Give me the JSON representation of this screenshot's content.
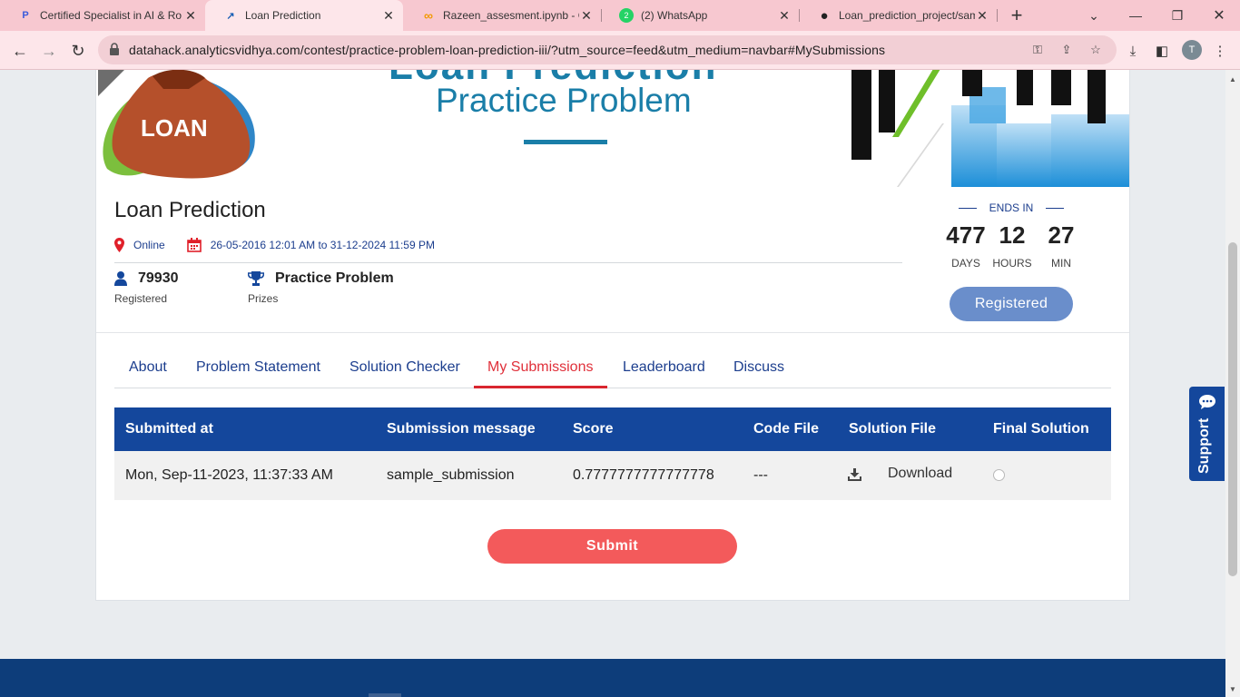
{
  "browser": {
    "tabs": [
      {
        "title": "Certified Specialist in AI & Ro",
        "icon": "p-letter-icon",
        "glyph": "P",
        "active": false
      },
      {
        "title": "Loan Prediction",
        "icon": "trend-icon",
        "glyph": "↗",
        "active": true
      },
      {
        "title": "Razeen_assesment.ipynb - Co",
        "icon": "colab-icon",
        "glyph": "∞",
        "active": false
      },
      {
        "title": "(2) WhatsApp",
        "icon": "whatsapp-icon",
        "glyph": "2",
        "active": false
      },
      {
        "title": "Loan_prediction_project/sam",
        "icon": "github-icon",
        "glyph": "●",
        "active": false
      }
    ],
    "close_glyph": "✕",
    "new_tab_glyph": "+",
    "url": "datahack.analyticsvidhya.com/contest/practice-problem-loan-prediction-iii/?utm_source=feed&utm_medium=navbar#MySubmissions",
    "profile_initial": "T"
  },
  "banner": {
    "top_title": "Loan Prediction",
    "subtitle": "Practice Problem",
    "bag_text": "LOAN"
  },
  "contest": {
    "title": "Loan Prediction",
    "location": "Online",
    "dates": "26-05-2016 12:01 AM to 31-12-2024 11:59 PM",
    "registered_count": "79930",
    "registered_label": "Registered",
    "prize": "Practice Problem",
    "prize_label": "Prizes"
  },
  "countdown": {
    "label": "ENDS IN",
    "days": "477",
    "days_label": "DAYS",
    "hours": "12",
    "hours_label": "HOURS",
    "minutes": "27",
    "minutes_label": "MIN",
    "button": "Registered"
  },
  "tabs": {
    "about": "About",
    "problem": "Problem Statement",
    "checker": "Solution Checker",
    "submissions": "My Submissions",
    "leaderboard": "Leaderboard",
    "discuss": "Discuss",
    "active": "My Submissions"
  },
  "table": {
    "headers": [
      "Submitted at",
      "Submission message",
      "Score",
      "Code File",
      "Solution File",
      "Final Solution"
    ],
    "rows": [
      {
        "submitted_at": "Mon, Sep-11-2023, 11:37:33 AM",
        "message": "sample_submission",
        "score": "0.7777777777777778",
        "code_file": "---",
        "solution_file": "Download",
        "final_selected": false
      }
    ]
  },
  "submit_label": "Submit",
  "support_label": "Support",
  "colors": {
    "primary_blue": "#14479c",
    "active_tab_red": "#d9262f",
    "submit_red": "#f35a5b",
    "registered_blue": "#6a8ecb",
    "chrome_pink": "#f7c8d0"
  }
}
